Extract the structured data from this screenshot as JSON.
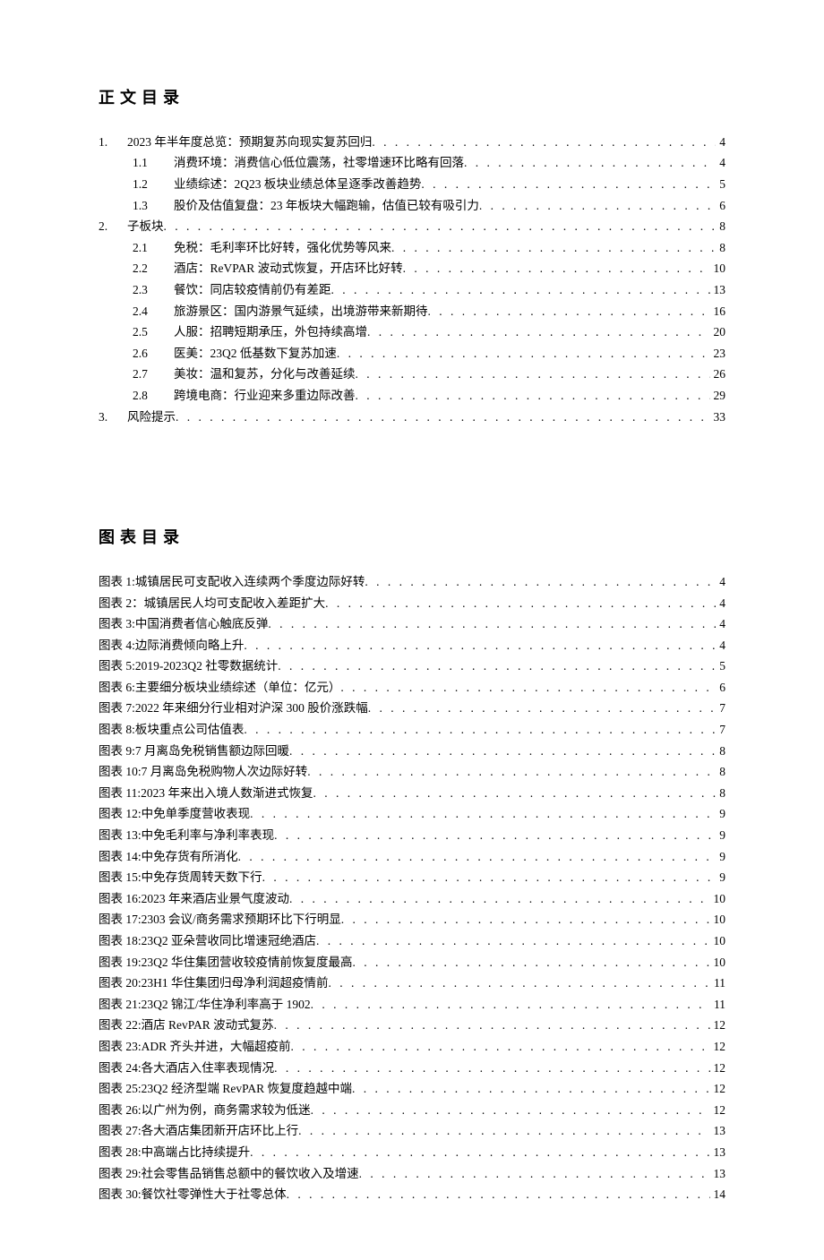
{
  "titles": {
    "toc": "正文目录",
    "figures": "图表目录"
  },
  "toc": [
    {
      "level": 1,
      "num": "1.",
      "label": "2023 年半年度总览：预期复苏向现实复苏回归",
      "page": "4"
    },
    {
      "level": 2,
      "num": "1.1",
      "label": "消费环境：消费信心低位震荡，社零增速环比略有回落",
      "page": "4"
    },
    {
      "level": 2,
      "num": "1.2",
      "label": "业绩综述：2Q23 板块业绩总体呈逐季改善趋势",
      "page": "5"
    },
    {
      "level": 2,
      "num": "1.3",
      "label": "股价及估值复盘：23 年板块大幅跑输，估值已较有吸引力",
      "page": "6"
    },
    {
      "level": 1,
      "num": "2.",
      "label": "子板块",
      "page": "8"
    },
    {
      "level": 2,
      "num": "2.1",
      "label": "免税：毛利率环比好转，强化优势等风来",
      "page": "8"
    },
    {
      "level": 2,
      "num": "2.2",
      "label": "酒店：ReVPAR 波动式恢复，开店环比好转",
      "page": "10"
    },
    {
      "level": 2,
      "num": "2.3",
      "label": "餐饮：同店较疫情前仍有差距",
      "page": "13"
    },
    {
      "level": 2,
      "num": "2.4",
      "label": "旅游景区：国内游景气延续，出境游带来新期待",
      "page": "16"
    },
    {
      "level": 2,
      "num": "2.5",
      "label": "人服：招聘短期承压，外包持续高增",
      "page": "20"
    },
    {
      "level": 2,
      "num": "2.6",
      "label": "医美：23Q2 低基数下复苏加速",
      "page": "23"
    },
    {
      "level": 2,
      "num": "2.7",
      "label": "美妆：温和复苏，分化与改善延续",
      "page": "26"
    },
    {
      "level": 2,
      "num": "2.8",
      "label": "跨境电商：行业迎来多重边际改善",
      "page": "29"
    },
    {
      "level": 1,
      "num": "3.",
      "label": "风险提示",
      "page": "33"
    }
  ],
  "figures": [
    {
      "label": "图表 1:城镇居民可支配收入连续两个季度边际好转",
      "page": "4"
    },
    {
      "label": "图表 2：城镇居民人均可支配收入差距扩大",
      "page": "4"
    },
    {
      "label": "图表 3:中国消费者信心触底反弹",
      "page": "4"
    },
    {
      "label": "图表 4:边际消费倾向略上升",
      "page": "4"
    },
    {
      "label": "图表 5:2019-2023Q2 社零数据统计",
      "page": "5"
    },
    {
      "label": "图表 6:主要细分板块业绩综述（单位：亿元）",
      "page": "6"
    },
    {
      "label": "图表 7:2022 年来细分行业相对沪深 300 股价涨跌幅",
      "page": "7"
    },
    {
      "label": "图表 8:板块重点公司估值表",
      "page": "7"
    },
    {
      "label": "图表 9:7 月离岛免税销售额边际回暖",
      "page": "8"
    },
    {
      "label": "图表 10:7 月离岛免税购物人次边际好转",
      "page": "8"
    },
    {
      "label": "图表 11:2023 年来出入境人数渐进式恢复",
      "page": "8"
    },
    {
      "label": "图表 12:中免单季度营收表现",
      "page": "9"
    },
    {
      "label": "图表 13:中免毛利率与净利率表现",
      "page": "9"
    },
    {
      "label": "图表 14:中免存货有所消化",
      "page": "9"
    },
    {
      "label": "图表 15:中免存货周转天数下行",
      "page": "9"
    },
    {
      "label": "图表 16:2023 年来酒店业景气度波动",
      "page": "10"
    },
    {
      "label": "图表 17:2303 会议/商务需求预期环比下行明显",
      "page": "10"
    },
    {
      "label": "图表 18:23Q2 亚朵营收同比增速冠绝酒店",
      "page": "10"
    },
    {
      "label": "图表 19:23Q2 华住集团营收较疫情前恢复度最高",
      "page": "10"
    },
    {
      "label": "图表 20:23H1 华住集团归母净利润超疫情前",
      "page": "11"
    },
    {
      "label": "图表 21:23Q2 锦江/华住净利率高于 1902",
      "page": "11"
    },
    {
      "label": "图表 22:酒店 RevPAR 波动式复苏",
      "page": "12"
    },
    {
      "label": "图表 23:ADR 齐头并进，大幅超疫前",
      "page": "12"
    },
    {
      "label": "图表 24:各大酒店入住率表现情况",
      "page": "12"
    },
    {
      "label": "图表 25:23Q2 经济型端 RevPAR 恢复度趋越中端",
      "page": "12"
    },
    {
      "label": "图表 26:以广州为例，商务需求较为低迷",
      "page": "12"
    },
    {
      "label": "图表 27:各大酒店集团新开店环比上行",
      "page": "13"
    },
    {
      "label": "图表 28:中高端占比持续提升",
      "page": "13"
    },
    {
      "label": "图表 29:社会零售品销售总额中的餐饮收入及增速",
      "page": "13"
    },
    {
      "label": "图表 30:餐饮社零弹性大于社零总体",
      "page": "14"
    }
  ]
}
